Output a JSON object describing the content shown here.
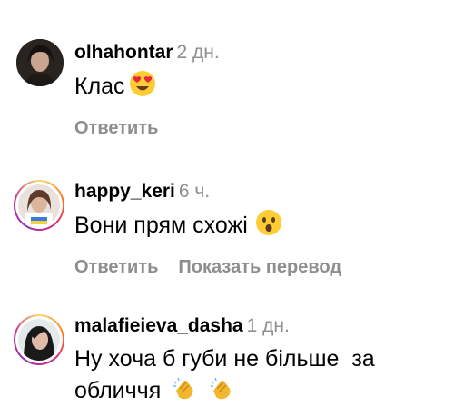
{
  "comments": [
    {
      "username": "olhahontar",
      "time": "2 дн.",
      "text": "Клас",
      "emoji": "heart-eyes",
      "actions": [
        "Ответить"
      ]
    },
    {
      "username": "happy_keri",
      "time": "6 ч.",
      "text": "Вони прям схожі",
      "emoji": "surprised",
      "actions": [
        "Ответить",
        "Показать перевод"
      ]
    },
    {
      "username": "malafieieva_dasha",
      "time": "1 дн.",
      "text_line1": "Ну хоча б губи не більше  за",
      "text_line2": "обличчя",
      "emoji": "clapping-hands"
    }
  ],
  "colors": {
    "secondary_text": "#8e8e8e",
    "story_ring": [
      "#feda75",
      "#fa7e1e",
      "#d62976",
      "#962fbf"
    ]
  }
}
